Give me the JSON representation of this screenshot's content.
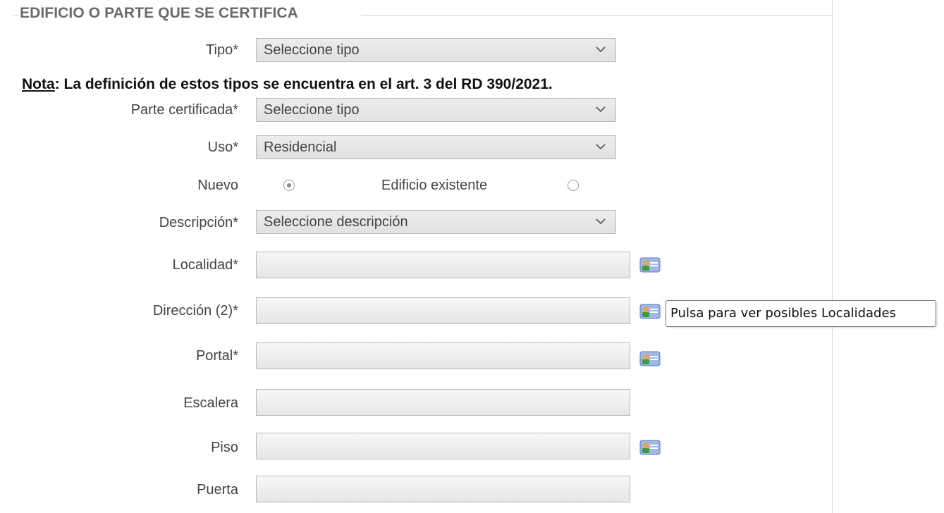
{
  "fieldset": {
    "legend": "EDIFICIO O PARTE QUE SE CERTIFICA"
  },
  "note": {
    "prefix": "Nota",
    "text": ": La definición de estos tipos se encuentra en el art. 3 del RD 390/2021."
  },
  "fields": {
    "tipo": {
      "label": "Tipo*",
      "value": "Seleccione tipo"
    },
    "parte_certificada": {
      "label": "Parte certificada*",
      "value": "Seleccione tipo"
    },
    "uso": {
      "label": "Uso*",
      "value": "Residencial"
    },
    "nuevo": {
      "label": "Nuevo",
      "selected": true
    },
    "edificio_existente": {
      "label": "Edificio existente",
      "selected": false
    },
    "descripcion": {
      "label": "Descripción*",
      "value": "Seleccione descripción"
    },
    "localidad": {
      "label": "Localidad*",
      "value": ""
    },
    "direccion": {
      "label": "Dirección (2)*",
      "value": ""
    },
    "portal": {
      "label": "Portal*",
      "value": ""
    },
    "escalera": {
      "label": "Escalera",
      "value": ""
    },
    "piso": {
      "label": "Piso",
      "value": ""
    },
    "puerta": {
      "label": "Puerta",
      "value": ""
    }
  },
  "tooltip": {
    "text": "Pulsa para ver posibles Localidades"
  },
  "icons": {
    "lookup": "contact-card-icon",
    "dropdown": "chevron-down-icon"
  },
  "colors": {
    "select_bg": "#e6e6e6",
    "border": "#bcbcbc",
    "label": "#444444",
    "legend": "#6a6a6a"
  }
}
